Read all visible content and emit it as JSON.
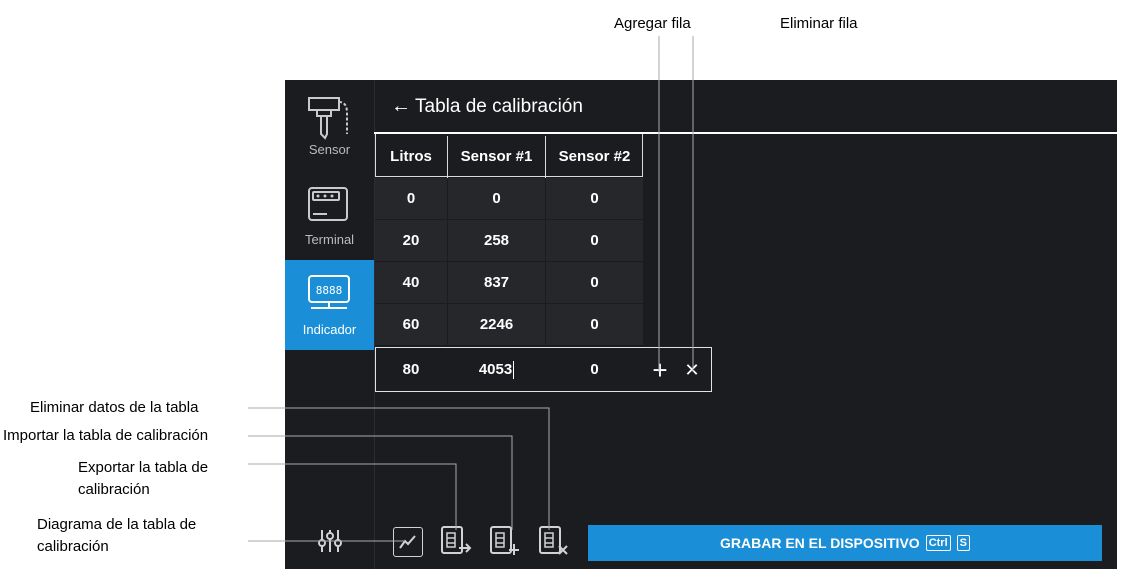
{
  "annotations": {
    "add_row": "Agregar fila",
    "delete_row": "Eliminar fila",
    "clear_table": "Eliminar datos de la tabla",
    "import_table": "Importar la tabla de calibración",
    "export_table": "Exportar la tabla de calibración",
    "diagram_table": "Diagrama de la tabla de calibración"
  },
  "sidebar": {
    "items": [
      {
        "label": "Sensor",
        "icon": "sensor-icon"
      },
      {
        "label": "Terminal",
        "icon": "terminal-icon"
      },
      {
        "label": "Indicador",
        "icon": "indicator-icon",
        "active": true
      }
    ]
  },
  "header": {
    "back_icon": "←",
    "title": "Tabla de calibración"
  },
  "table": {
    "columns": [
      "Litros",
      "Sensor #1",
      "Sensor #2"
    ],
    "rows": [
      [
        "0",
        "0",
        "0"
      ],
      [
        "20",
        "258",
        "0"
      ],
      [
        "40",
        "837",
        "0"
      ],
      [
        "60",
        "2246",
        "0"
      ],
      [
        "80",
        "4053",
        "0"
      ]
    ],
    "row_actions": {
      "add": "+",
      "delete": "✕"
    }
  },
  "toolbar": {
    "save_label": "GRABAR EN EL DISPOSITIVO",
    "shortcut_ctrl": "Ctrl",
    "shortcut_key": "S"
  },
  "colors": {
    "accent": "#1a8fd8",
    "background": "#1b1c1f",
    "row": "#26272b"
  }
}
